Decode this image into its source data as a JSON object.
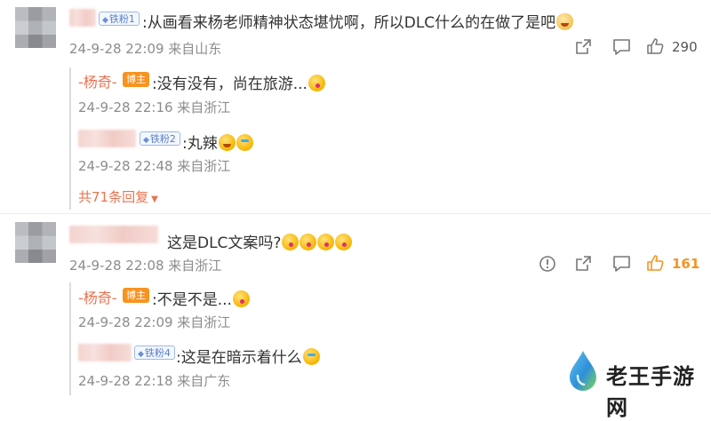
{
  "colors": {
    "accent": "#eb7350",
    "host_badge": "#f7931e",
    "fan_badge": "#5b7fc7",
    "meta": "#8c8c8c"
  },
  "comments": [
    {
      "badge": "铁粉1",
      "text": ":从画看来杨老师精神状态堪忧啊，所以DLC什么的在做了是吧",
      "meta": "24-9-28 22:09 来自山东",
      "like_count": "290",
      "replies": [
        {
          "author": "-杨奇-",
          "badge": "博主",
          "text": ":没有没有，尚在旅游...",
          "meta": "24-9-28 22:16 来自浙江"
        },
        {
          "author": "",
          "badge": "铁粉2",
          "text": ":丸辣",
          "meta": "24-9-28 22:48 来自浙江"
        }
      ],
      "more_replies": "共71条回复"
    },
    {
      "badge": "",
      "text": "这是DLC文案吗?",
      "meta": "24-9-28 22:08 来自浙江",
      "like_count": "161",
      "replies": [
        {
          "author": "-杨奇-",
          "badge": "博主",
          "text": ":不是不是...",
          "meta": "24-9-28 22:09 来自浙江"
        },
        {
          "author": "",
          "badge": "铁粉4",
          "text": ":这是在暗示着什么",
          "meta": "24-9-28 22:18 来自广东"
        }
      ]
    }
  ],
  "watermark": "老王手游网",
  "icons": [
    "share-icon",
    "comment-icon",
    "like-icon",
    "report-icon",
    "dropdown-triangle-icon"
  ]
}
